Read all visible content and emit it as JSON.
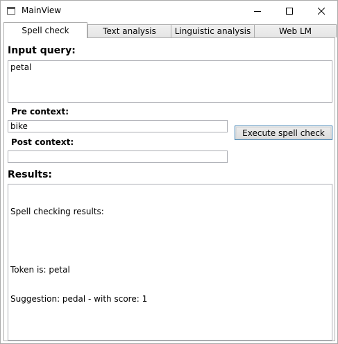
{
  "window": {
    "title": "MainView",
    "icons": [
      "app-window-icon",
      "minimize-icon",
      "maximize-icon",
      "close-icon"
    ]
  },
  "tabs": [
    {
      "label": "Spell check",
      "active": true
    },
    {
      "label": "Text analysis",
      "active": false
    },
    {
      "label": "Linguistic analysis",
      "active": false
    },
    {
      "label": "Web LM",
      "active": false
    }
  ],
  "spellcheck": {
    "input_heading": "Input query:",
    "input_value": "petal",
    "pre_context_label": "Pre context:",
    "pre_context_value": "bike",
    "post_context_label": "Post context:",
    "post_context_value": "",
    "execute_button_label": "Execute spell check",
    "results_heading": "Results:",
    "results_lines": [
      "Spell checking results:",
      "",
      "Token is: petal",
      "Suggestion: pedal - with score: 1"
    ]
  },
  "colors": {
    "button_border": "#3c7fb1",
    "textbox_border": "#abadb3",
    "tab_border": "#acacac"
  }
}
